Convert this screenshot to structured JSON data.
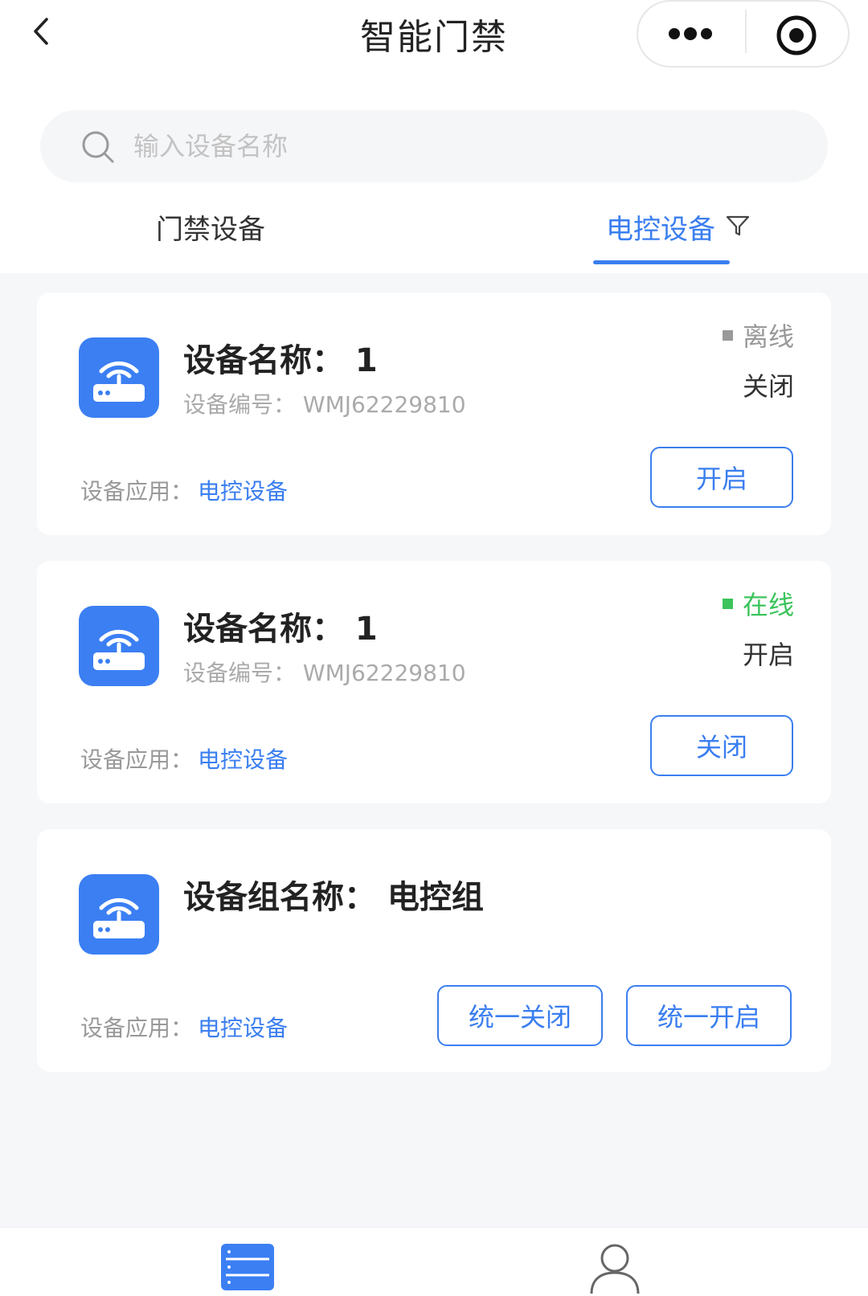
{
  "header": {
    "title": "智能门禁"
  },
  "search": {
    "placeholder": "输入设备名称"
  },
  "tabs": [
    {
      "label": "门禁设备",
      "active": false
    },
    {
      "label": "电控设备",
      "active": true
    }
  ],
  "colors": {
    "accent": "#3a7ef0",
    "online": "#3cc45c",
    "offline": "#999999",
    "device_icon_bg": "#3b7ff3"
  },
  "cards": [
    {
      "name": "设备名称：  1",
      "code": "设备编号：  WMJ62229810",
      "app_label": "设备应用：",
      "app_value": "电控设备",
      "status": "离线",
      "state": "关闭",
      "button": "开启"
    },
    {
      "name": "设备名称：  1",
      "code": "设备编号：  WMJ62229810",
      "app_label": "设备应用：",
      "app_value": "电控设备",
      "status": "在线",
      "state": "开启",
      "button": "关闭"
    }
  ],
  "group": {
    "name": "设备组名称：  电控组",
    "app_label": "设备应用：",
    "app_value": "电控设备",
    "button_close_all": "统一关闭",
    "button_open_all": "统一开启"
  },
  "tabbar": {
    "items": [
      "list-icon",
      "user-icon"
    ]
  }
}
